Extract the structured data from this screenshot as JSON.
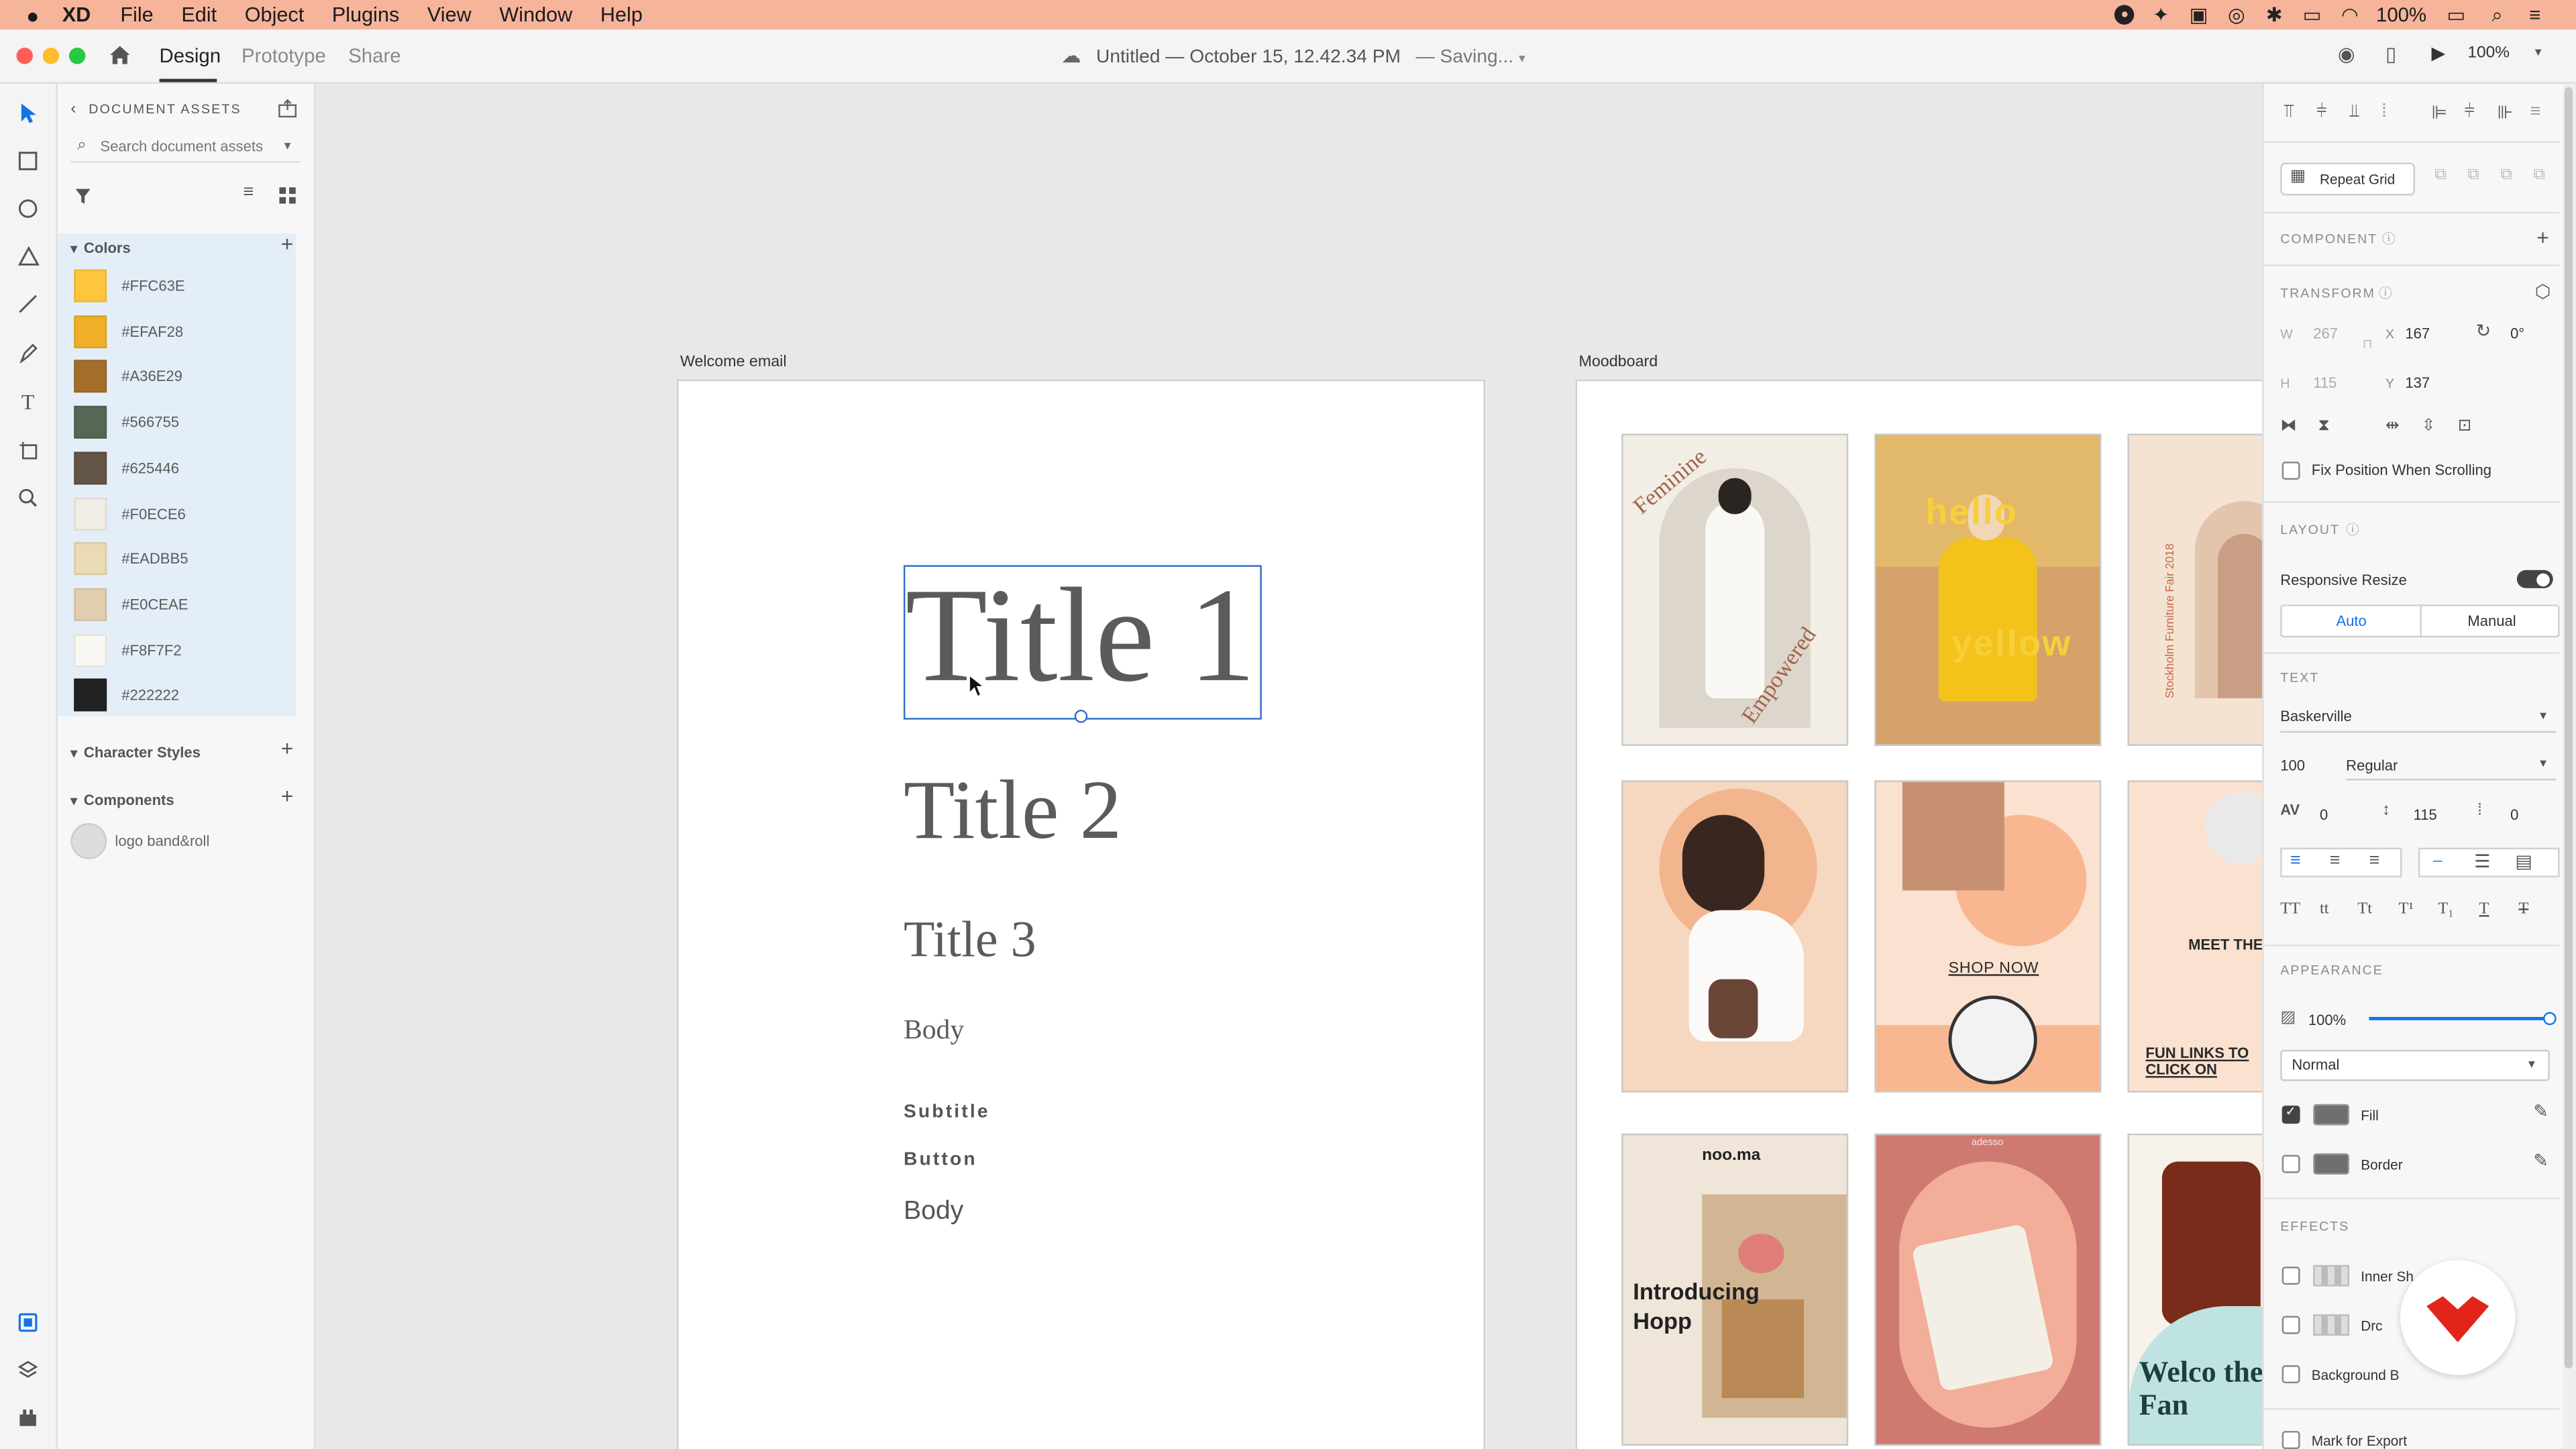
{
  "menubar": {
    "app": "XD",
    "items": [
      "File",
      "Edit",
      "Object",
      "Plugins",
      "View",
      "Window",
      "Help"
    ],
    "battery": "100%"
  },
  "titlebar": {
    "tabs": [
      "Design",
      "Prototype",
      "Share"
    ],
    "doc_title": "Untitled — October 15, 12.42.34 PM",
    "status": "—  Saving...",
    "zoom": "100%"
  },
  "assets": {
    "header": "DOCUMENT ASSETS",
    "search_placeholder": "Search document assets",
    "colors_label": "Colors",
    "colors": [
      {
        "hex": "#FFC63E"
      },
      {
        "hex": "#EFAF28"
      },
      {
        "hex": "#A36E29"
      },
      {
        "hex": "#566755"
      },
      {
        "hex": "#625446"
      },
      {
        "hex": "#F0ECE6"
      },
      {
        "hex": "#EADBB5"
      },
      {
        "hex": "#E0CEAE"
      },
      {
        "hex": "#F8F7F2"
      },
      {
        "hex": "#222222"
      }
    ],
    "character_styles_label": "Character Styles",
    "components_label": "Components",
    "component_item": "logo band&roll"
  },
  "canvas": {
    "email_label": "Welcome email",
    "mood_label": "Moodboard",
    "styles": {
      "t1": "Title 1",
      "t2": "Title 2",
      "t3": "Title 3",
      "body1": "Body",
      "subtitle": "Subtitle",
      "button": "Button",
      "body2": "Body"
    },
    "cards": {
      "c1a": "Feminine",
      "c1b": "Empowered",
      "c2a": "hello",
      "c2b": "yellow",
      "c3a": "Stockholm Furniture Fair 2018",
      "c5": "SHOP NOW",
      "c6a": "MEET THE AR",
      "c6b": "FUN LINKS TO CLICK ON",
      "c7a": "noo.ma",
      "c7b": "Introducing Hopp",
      "c8": "adesso",
      "c9": "Welco the Oli Fan"
    }
  },
  "props": {
    "repeat_grid": "Repeat Grid",
    "component": "COMPONENT",
    "transform": "TRANSFORM",
    "w_label": "W",
    "w": "267",
    "x_label": "X",
    "x": "167",
    "rot": "0°",
    "h_label": "H",
    "h": "115",
    "y_label": "Y",
    "y": "137",
    "fix_position": "Fix Position When Scrolling",
    "layout": "LAYOUT",
    "responsive_resize": "Responsive Resize",
    "auto": "Auto",
    "manual": "Manual",
    "text": "TEXT",
    "font": "Baskerville",
    "font_size": "100",
    "font_weight": "Regular",
    "char_spacing": "0",
    "line_spacing": "115",
    "para_spacing": "0",
    "case_opts": [
      "TT",
      "tt",
      "Tt",
      "T¹",
      "T₁",
      "T",
      "T"
    ],
    "appearance": "APPEARANCE",
    "opacity": "100%",
    "opacity_value": 1.0,
    "blend": "Normal",
    "fill": "Fill",
    "border": "Border",
    "effects": "EFFECTS",
    "inner_shadow": "Inner Sh",
    "drop_shadow": "Drc",
    "background_blur": "Background B",
    "mark_export": "Mark for Export"
  },
  "colors": {
    "accent": "#1473e6",
    "menubar": "#f6b49b",
    "badge": "#e1251b"
  }
}
